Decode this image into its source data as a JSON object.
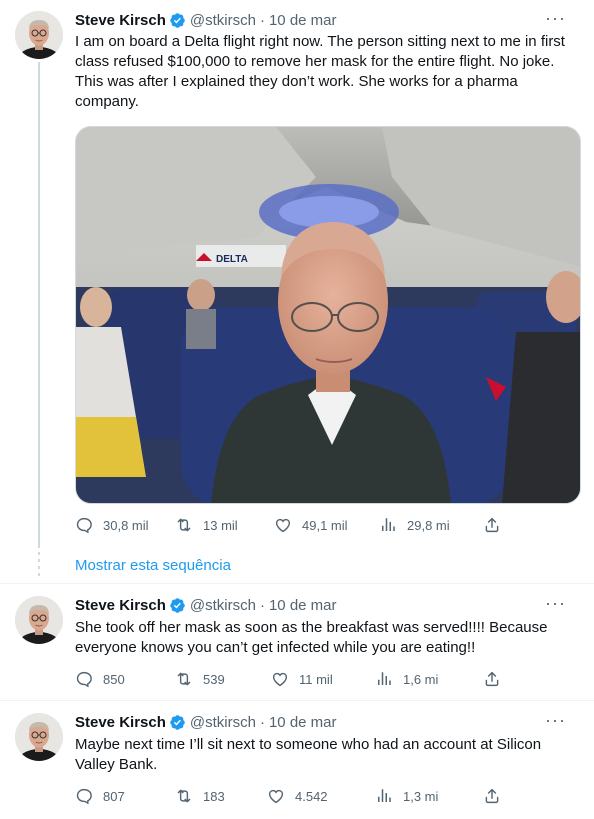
{
  "author": {
    "name": "Steve Kirsch",
    "handle": "@stkirsch",
    "date": "10 de mar",
    "separator": "·"
  },
  "tweets": [
    {
      "text": "I am on board a Delta flight right now. The person sitting next to me in first class refused $100,000 to remove her mask for the entire flight. No joke. This was after I explained they don’t work. She works for a pharma company.",
      "media_sign": "DELTA",
      "stats": {
        "replies": "30,8 mil",
        "retweets": "13 mil",
        "likes": "49,1 mil",
        "views": "29,8 mi"
      }
    },
    {
      "text": "She took off her mask as soon as the breakfast was served!!!! Because everyone knows you can’t get infected while you are eating!!",
      "stats": {
        "replies": "850",
        "retweets": "539",
        "likes": "11 mil",
        "views": "1,6 mi"
      }
    },
    {
      "text": "Maybe next time I’ll sit next to someone who had an account at Silicon Valley Bank.",
      "stats": {
        "replies": "807",
        "retweets": "183",
        "likes": "4.542",
        "views": "1,3 mi"
      }
    }
  ],
  "show_thread_label": "Mostrar esta sequência",
  "more_label": "···",
  "colors": {
    "accent": "#1d9bf0",
    "secondary_text": "#536471",
    "primary_text": "#0f1419"
  }
}
